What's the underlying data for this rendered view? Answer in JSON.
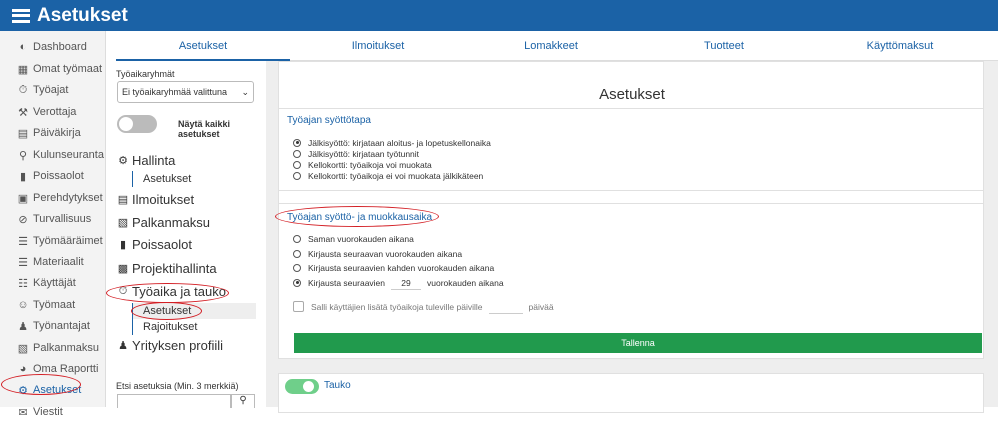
{
  "app": {
    "title": "Asetukset"
  },
  "sidebar": {
    "items": [
      {
        "label": "Dashboard",
        "icon": "dashboard-icon",
        "glyph": "◐"
      },
      {
        "label": "Omat työmaat",
        "icon": "worksites-icon",
        "glyph": "▦"
      },
      {
        "label": "Työajat",
        "icon": "timer-icon",
        "glyph": "⏱"
      },
      {
        "label": "Verottaja",
        "icon": "gavel-icon",
        "glyph": "⚒"
      },
      {
        "label": "Päiväkirja",
        "icon": "book-icon",
        "glyph": "▤"
      },
      {
        "label": "Kulunseuranta",
        "icon": "location-icon",
        "glyph": "⚲"
      },
      {
        "label": "Poissaolot",
        "icon": "absence-icon",
        "glyph": "▮"
      },
      {
        "label": "Perehdytykset",
        "icon": "orientation-icon",
        "glyph": "▣"
      },
      {
        "label": "Turvallisuus",
        "icon": "safety-icon",
        "glyph": "⊘"
      },
      {
        "label": "Työmääräimet",
        "icon": "work-orders-icon",
        "glyph": "☰"
      },
      {
        "label": "Materiaalit",
        "icon": "materials-icon",
        "glyph": "☰"
      },
      {
        "label": "Käyttäjät",
        "icon": "users-icon",
        "glyph": "☷"
      },
      {
        "label": "Työmaat",
        "icon": "worksite-icon",
        "glyph": "☺"
      },
      {
        "label": "Työnantajat",
        "icon": "employer-icon",
        "glyph": "♟"
      },
      {
        "label": "Palkanmaksu",
        "icon": "payroll-icon",
        "glyph": "▧"
      },
      {
        "label": "Oma Raportti",
        "icon": "report-icon",
        "glyph": "◕"
      },
      {
        "label": "Asetukset",
        "icon": "gear-icon",
        "glyph": "⚙"
      },
      {
        "label": "Viestit",
        "icon": "mail-icon",
        "glyph": "✉"
      }
    ]
  },
  "tabs": [
    {
      "label": "Asetukset"
    },
    {
      "label": "Ilmoitukset"
    },
    {
      "label": "Lomakkeet"
    },
    {
      "label": "Tuotteet"
    },
    {
      "label": "Käyttömaksut"
    }
  ],
  "left": {
    "group_label": "Työaikaryhmät",
    "group_select": "Ei työaikaryhmää valittuna",
    "toggle_label": "Näytä kaikki asetukset",
    "sections": [
      {
        "label": "Hallinta",
        "icon": "gear-icon",
        "glyph": "⚙"
      },
      {
        "label": "Ilmoitukset",
        "icon": "notification-icon",
        "glyph": "▤"
      },
      {
        "label": "Palkanmaksu",
        "icon": "payroll-icon",
        "glyph": "▧"
      },
      {
        "label": "Poissaolot",
        "icon": "absence-icon",
        "glyph": "▮"
      },
      {
        "label": "Projektihallinta",
        "icon": "project-icon",
        "glyph": "▩"
      },
      {
        "label": "Työaika ja tauko",
        "icon": "timer-icon",
        "glyph": "⏱"
      },
      {
        "label": "Yrityksen profiili",
        "icon": "profile-icon",
        "glyph": "♟"
      }
    ],
    "hallinta_sub": "Asetukset",
    "tyoaika_sub": [
      "Asetukset",
      "Rajoitukset"
    ],
    "search_label": "Etsi asetuksia (Min. 3 merkkiä)",
    "search_icon": "search-icon"
  },
  "main": {
    "title": "Asetukset",
    "entry_card": {
      "title": "Työajan syöttötapa",
      "options": [
        "Jälkisyöttö: kirjataan aloitus- ja lopetuskellonaika",
        "Jälkisyöttö: kirjataan työtunnit",
        "Kellokortti: työaikoja voi muokata",
        "Kellokortti: työaikoja ei voi muokata jälkikäteen"
      ],
      "selected": 0
    },
    "edit_card": {
      "title": "Työajan syöttö- ja muokkausaika",
      "options": [
        "Saman vuorokauden aikana",
        "Kirjausta seuraavan vuorokauden aikana",
        "Kirjausta seuraavien kahden vuorokauden aikana"
      ],
      "custom_prefix": "Kirjausta seuraavien",
      "custom_value": "29",
      "custom_suffix": "vuorokauden aikana",
      "future_prefix": "Salli käyttäjien lisätä työaikoja tuleville päiville",
      "future_suffix": "päivää",
      "save_label": "Tallenna"
    },
    "break_card": {
      "label": "Tauko"
    }
  },
  "colors": {
    "primary": "#1b62a6",
    "success": "#219a4d",
    "annotation": "#d31f25"
  }
}
